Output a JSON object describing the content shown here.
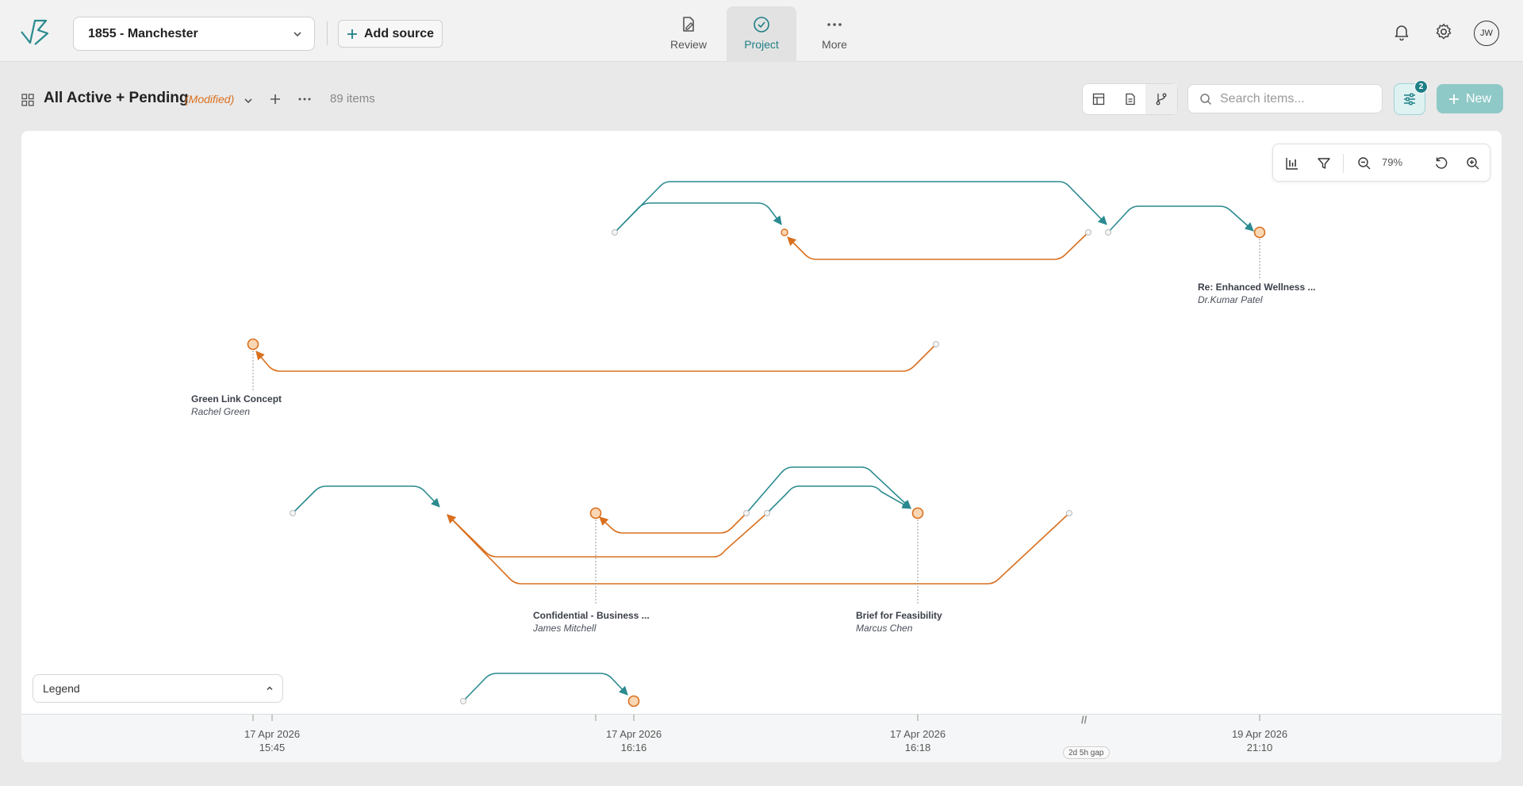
{
  "topbar": {
    "project": "1855 - Manchester",
    "add_source": "Add source",
    "tabs": [
      {
        "label": "Review",
        "icon": "file-pen-icon"
      },
      {
        "label": "Project",
        "icon": "check-circle-icon"
      },
      {
        "label": "More",
        "icon": "more-dots-icon"
      }
    ],
    "active_tab": "Project",
    "avatar": "JW"
  },
  "view": {
    "title": "All Active + Pending",
    "modified": "(Modified)",
    "count": "89 items",
    "search_placeholder": "Search items...",
    "filter_badge": "2",
    "new_label": "New"
  },
  "canvas": {
    "zoom": "79%",
    "legend_label": "Legend",
    "gap_label": "2d 5h gap",
    "nodes": [
      {
        "title": "Re: Enhanced Wellness ...",
        "author": "Dr.Kumar Patel"
      },
      {
        "title": "Green Link Concept",
        "author": "Rachel Green"
      },
      {
        "title": "Confidential - Business ...",
        "author": "James Mitchell"
      },
      {
        "title": "Brief for Feasibility",
        "author": "Marcus Chen"
      }
    ],
    "ticks": [
      {
        "date": "17 Apr 2026",
        "time": "15:45"
      },
      {
        "date": "17 Apr 2026",
        "time": "16:16"
      },
      {
        "date": "17 Apr 2026",
        "time": "16:18"
      },
      {
        "date": "19 Apr 2026",
        "time": "21:10"
      }
    ]
  },
  "colors": {
    "teal": "#2a8a8f",
    "orange": "#d9701f",
    "node_fill": "#fad7b4"
  }
}
